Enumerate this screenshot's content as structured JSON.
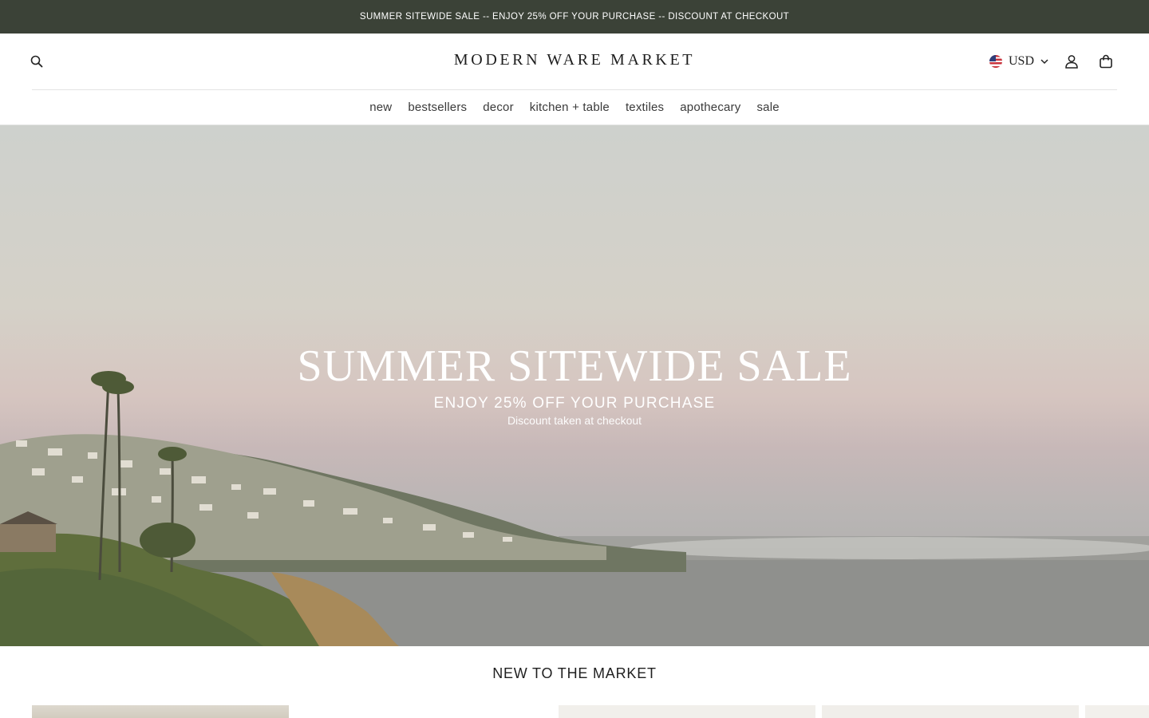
{
  "announcement": {
    "text": "SUMMER SITEWIDE SALE -- ENJOY 25% OFF YOUR PURCHASE -- DISCOUNT AT CHECKOUT"
  },
  "header": {
    "logo": "MODERN WARE MARKET",
    "currency": "USD",
    "icons": {
      "search": "search-icon",
      "currency_flag": "us-flag-icon",
      "dropdown": "chevron-down-icon",
      "account": "user-icon",
      "cart": "shopping-bag-icon"
    }
  },
  "nav": {
    "items": [
      {
        "label": "new"
      },
      {
        "label": "bestsellers"
      },
      {
        "label": "decor"
      },
      {
        "label": "kitchen + table"
      },
      {
        "label": "textiles"
      },
      {
        "label": "apothecary"
      },
      {
        "label": "sale"
      }
    ]
  },
  "hero": {
    "title": "SUMMER SITEWIDE SALE",
    "subtitle": "ENJOY 25% OFF YOUR PURCHASE",
    "note": "Discount taken at checkout"
  },
  "new_section": {
    "title": "NEW TO THE MARKET"
  },
  "colors": {
    "announcement_bg": "#3b4237",
    "text": "#222222",
    "hero_text": "#ffffff"
  }
}
